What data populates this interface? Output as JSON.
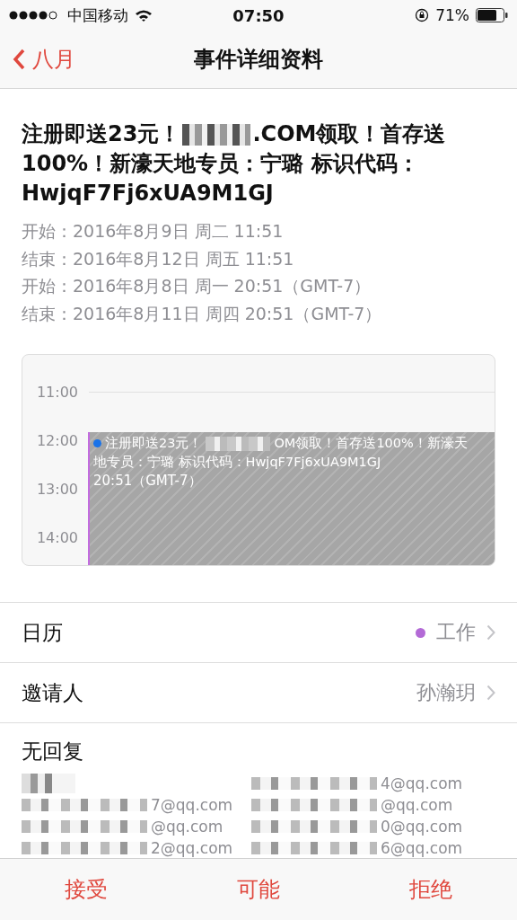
{
  "status_bar": {
    "carrier": "中国移动",
    "time": "07:50",
    "battery": "71%"
  },
  "nav": {
    "back": "八月",
    "title": "事件详细资料"
  },
  "event": {
    "title_lines": [
      [
        {
          "kind": "text",
          "text": "注册即送23元！"
        },
        {
          "kind": "redacted"
        },
        {
          "kind": "text",
          "text": ".COM领取！首存送"
        }
      ],
      [
        {
          "kind": "text",
          "text": "100%！新濠天地专员：宁璐 标识代码："
        }
      ],
      [
        {
          "kind": "text",
          "text": "HwjqF7Fj6xUA9M1GJ"
        }
      ]
    ],
    "times": [
      "开始：2016年8月9日 周二 11:51",
      "结束：2016年8月12日 周五 11:51",
      "开始：2016年8月8日 周一 20:51（GMT-7）",
      "结束：2016年8月11日 周四 20:51（GMT-7）"
    ]
  },
  "day_view": {
    "hours": [
      "11:00",
      "12:00",
      "13:00",
      "14:00"
    ],
    "block": {
      "lines": [
        [
          {
            "kind": "text",
            "text": "注册即送23元！"
          },
          {
            "kind": "redacted"
          },
          {
            "kind": "text",
            "text": "OM领取！首存送100%！新濠天"
          }
        ],
        [
          {
            "kind": "text",
            "text": "地专员：宁璐 标识代码：HwjqF7Fj6xUA9M1GJ"
          }
        ]
      ],
      "time": "20:51（GMT-7）",
      "color": "#1a73e8"
    }
  },
  "rows": [
    {
      "label": "日历",
      "value": "工作",
      "color": "#b36ad6"
    },
    {
      "label": "邀请人",
      "value": "孙瀚玥"
    }
  ],
  "invitees": {
    "heading": "无回复",
    "columns": [
      [
        {
          "kind": "redacted"
        },
        {
          "kind": "email",
          "text": "7@qq.com"
        },
        {
          "kind": "email",
          "text": "@qq.com"
        },
        {
          "kind": "email",
          "text": "2@qq.com"
        }
      ],
      [
        {
          "kind": "email",
          "text": "4@qq.com"
        },
        {
          "kind": "email",
          "text": "@qq.com"
        },
        {
          "kind": "email",
          "text": "0@qq.com"
        },
        {
          "kind": "email",
          "text": "6@qq.com"
        }
      ]
    ]
  },
  "actions": [
    "接受",
    "可能",
    "拒绝"
  ]
}
